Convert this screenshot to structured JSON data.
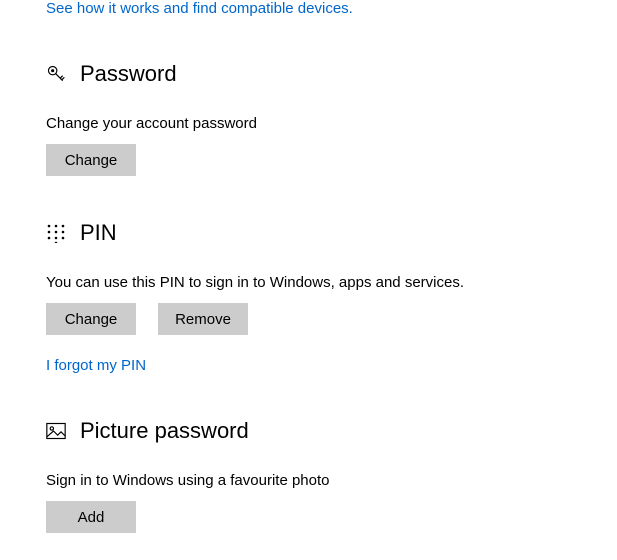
{
  "top_link": "See how it works and find compatible devices.",
  "password": {
    "title": "Password",
    "description": "Change your account password",
    "change_label": "Change"
  },
  "pin": {
    "title": "PIN",
    "description": "You can use this PIN to sign in to Windows, apps and services.",
    "change_label": "Change",
    "remove_label": "Remove",
    "forgot_link": "I forgot my PIN"
  },
  "picture_password": {
    "title": "Picture password",
    "description": "Sign in to Windows using a favourite photo",
    "add_label": "Add"
  }
}
